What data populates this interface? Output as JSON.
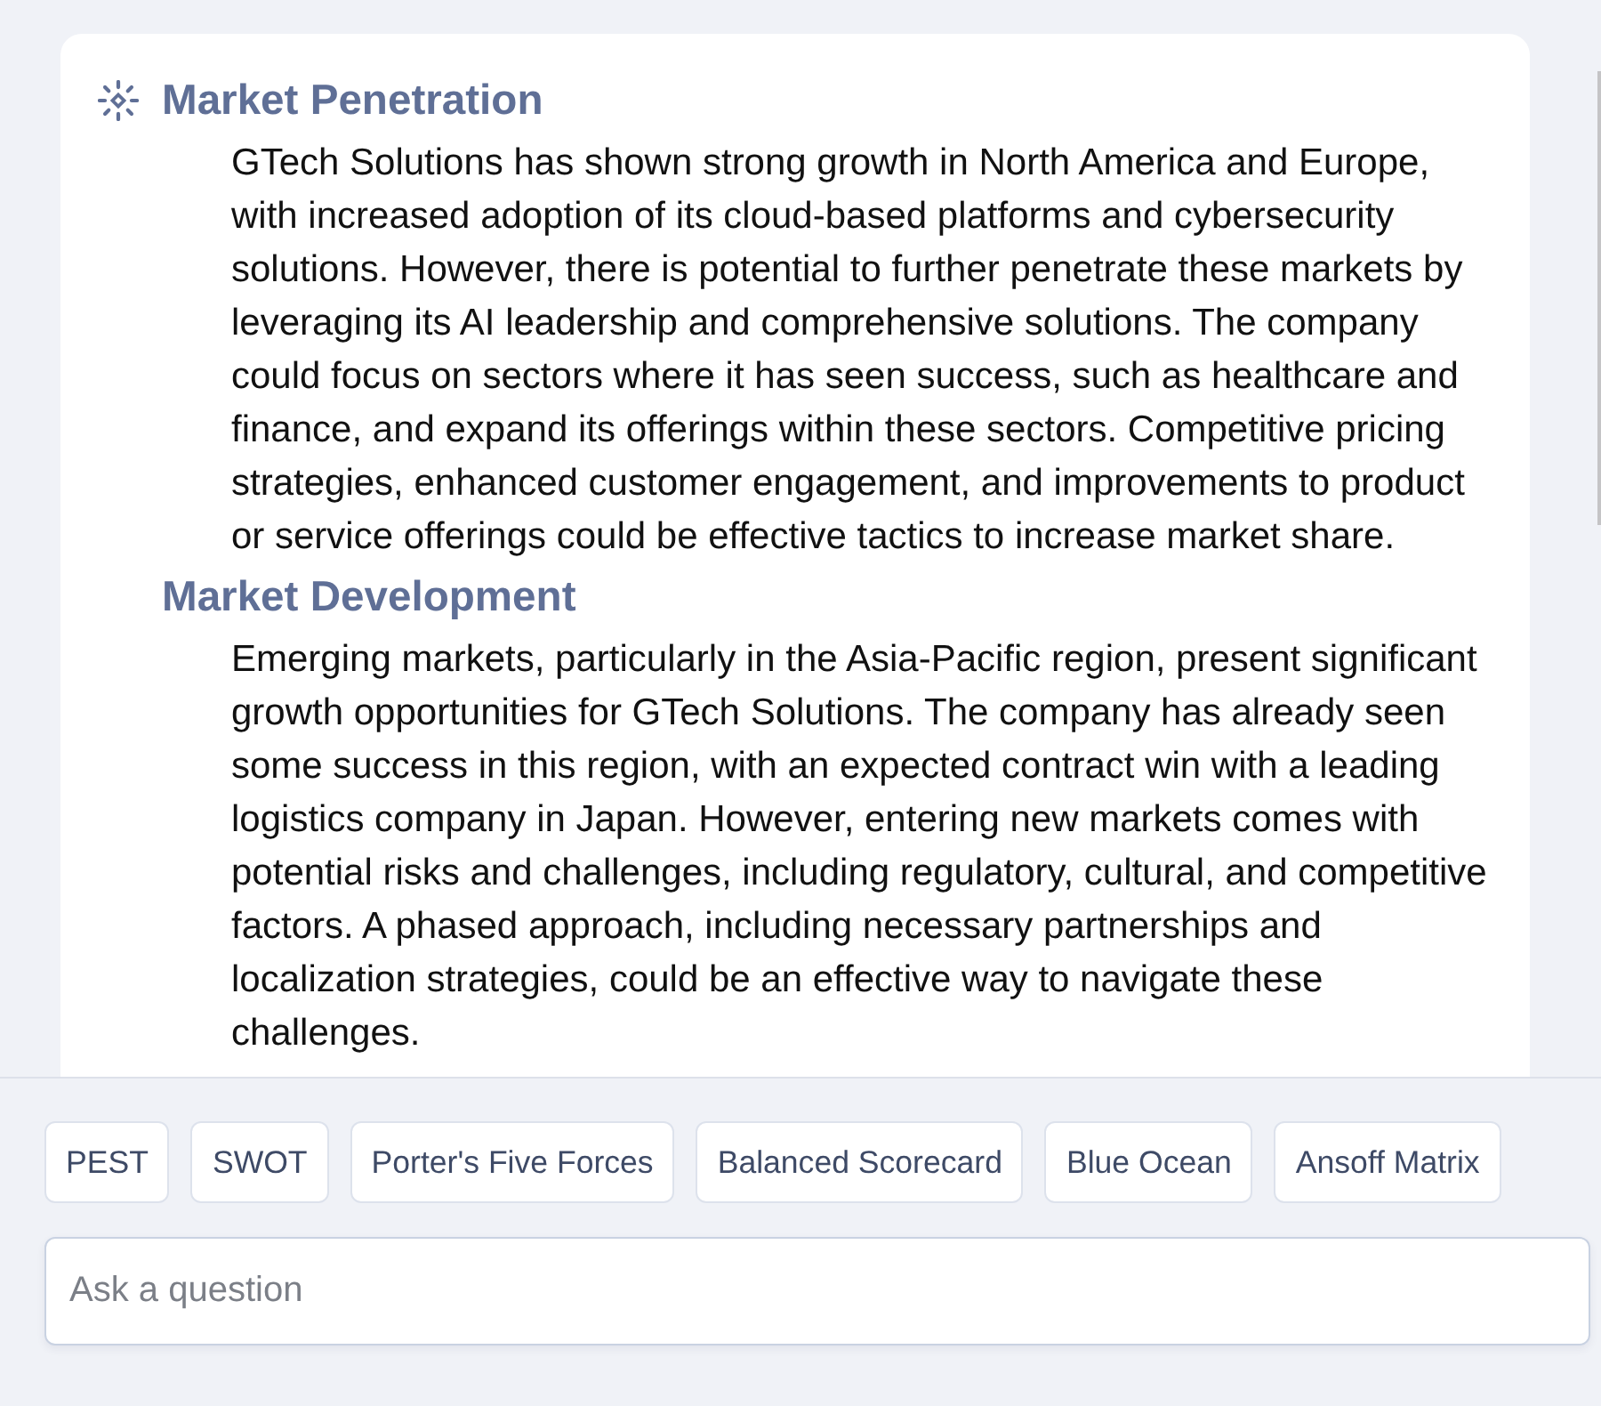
{
  "message": {
    "sections": [
      {
        "heading": "Market Penetration",
        "body": "GTech Solutions has shown strong growth in North America and Europe, with increased adoption of its cloud-based platforms and cybersecurity solutions. However, there is potential to further penetrate these markets by leveraging its AI leadership and comprehensive solutions. The company could focus on sectors where it has seen success, such as healthcare and finance, and expand its offerings within these sectors. Competitive pricing strategies, enhanced customer engagement, and improvements to product or service offerings could be effective tactics to increase market share."
      },
      {
        "heading": "Market Development",
        "body": "Emerging markets, particularly in the Asia-Pacific region, present significant growth opportunities for GTech Solutions. The company has already seen some success in this region, with an expected contract win with a leading logistics company in Japan. However, entering new markets comes with potential risks and challenges, including regulatory, cultural, and competitive factors. A phased approach, including necessary partnerships and localization strategies, could be an effective way to navigate these challenges."
      }
    ]
  },
  "suggestions": [
    "PEST",
    "SWOT",
    "Porter's Five Forces",
    "Balanced Scorecard",
    "Blue Ocean",
    "Ansoff Matrix"
  ],
  "question_input": {
    "placeholder": "Ask a question"
  }
}
